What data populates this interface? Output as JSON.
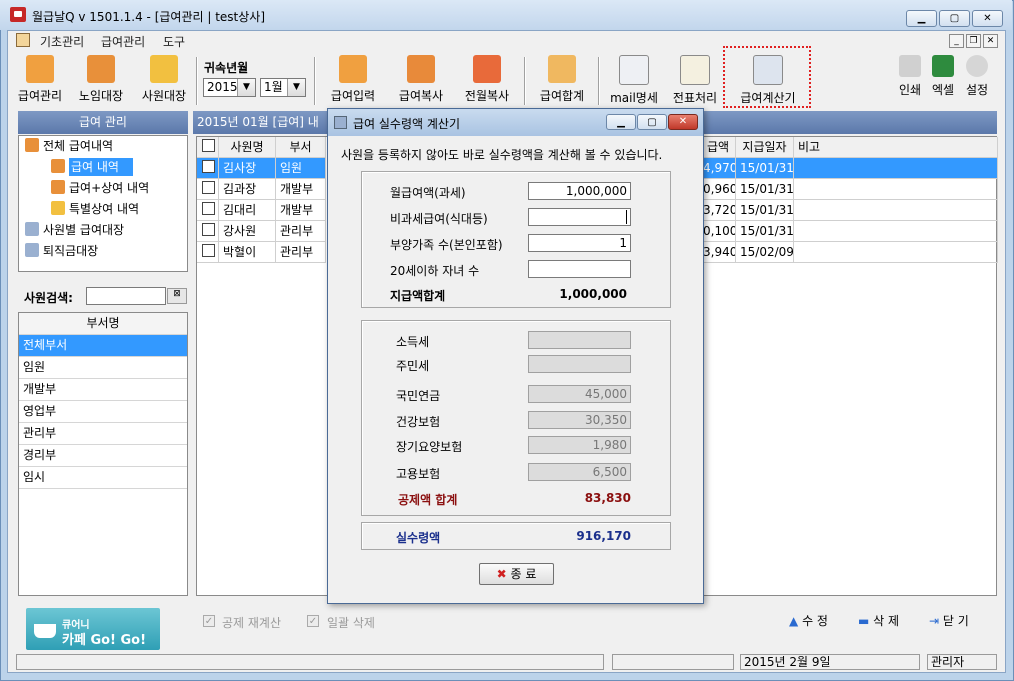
{
  "app": {
    "title": "월급날Q  v 1501.1.4 - [급여관리 | test상사]"
  },
  "menu": [
    "기초관리",
    "급여관리",
    "도구"
  ],
  "toolbar": {
    "items": [
      "급여관리",
      "노임대장",
      "사원대장",
      "급여입력",
      "급여복사",
      "전월복사",
      "급여합계",
      "mail명세",
      "전표처리",
      "급여계산기"
    ],
    "right": [
      "인쇄",
      "엑셀",
      "설정"
    ],
    "period_label": "귀속년월",
    "year": "2015",
    "month": "1월"
  },
  "left_panel": {
    "header": "급여 관리",
    "tree": [
      "전체 급여내역",
      "급여 내역",
      "급여+상여 내역",
      "특별상여 내역",
      "사원별 급여대장",
      "퇴직금대장"
    ],
    "search_label": "사원검색:",
    "dept_header": "부서명",
    "depts": [
      "전체부서",
      "임원",
      "개발부",
      "영업부",
      "관리부",
      "경리부",
      "임시"
    ]
  },
  "grid": {
    "banner": "2015년 01월 [급여] 내",
    "columns": [
      "□",
      "사원명",
      "부서",
      "급액",
      "지급일자",
      "비고"
    ],
    "rows": [
      {
        "name": "김사장",
        "dept": "임원",
        "amount": "4,970",
        "date": "15/01/31"
      },
      {
        "name": "김과장",
        "dept": "개발부",
        "amount": "0,960",
        "date": "15/01/31"
      },
      {
        "name": "김대리",
        "dept": "개발부",
        "amount": "3,720",
        "date": "15/01/31"
      },
      {
        "name": "강사원",
        "dept": "관리부",
        "amount": "0,100",
        "date": "15/01/31"
      },
      {
        "name": "박혈이",
        "dept": "관리부",
        "amount": "3,940",
        "date": "15/02/09"
      }
    ]
  },
  "dialog": {
    "title": "급여 실수령액 계산기",
    "description": "사원을 등록하지 않아도 바로 실수령액을 계산해 볼 수 있습니다.",
    "inputs": {
      "salary_label": "월급여액(과세)",
      "salary_value": "1,000,000",
      "nontax_label": "비과세급여(식대등)",
      "nontax_value": "",
      "dependents_label": "부양가족 수(본인포함)",
      "dependents_value": "1",
      "children_label": "20세이하 자녀 수",
      "children_value": "",
      "total_label": "지급액합계",
      "total_value": "1,000,000"
    },
    "deductions": {
      "income_tax_label": "소득세",
      "income_tax_value": "",
      "resident_tax_label": "주민세",
      "resident_tax_value": "",
      "pension_label": "국민연금",
      "pension_value": "45,000",
      "health_label": "건강보험",
      "health_value": "30,350",
      "longterm_label": "장기요양보험",
      "longterm_value": "1,980",
      "employment_label": "고용보험",
      "employment_value": "6,500",
      "total_label": "공제액 합계",
      "total_value": "83,830"
    },
    "net_label": "실수령액",
    "net_value": "916,170",
    "close_label": "종  료"
  },
  "bottom": {
    "cafe_line1": "큐어니",
    "cafe_line2": "카페 Go! Go!",
    "recalc_label": "공제 재계산",
    "bulk_delete_label": "일괄 삭제",
    "edit_label": "수 정",
    "delete_label": "삭 제",
    "close_label": "닫 기"
  },
  "status": {
    "date": "2015년 2월 9일",
    "user": "관리자"
  },
  "colors": {
    "accent": "#3399ff",
    "header": "#5b78aa",
    "deduction_red": "#8b1010",
    "net_blue": "#1a2f8c"
  }
}
